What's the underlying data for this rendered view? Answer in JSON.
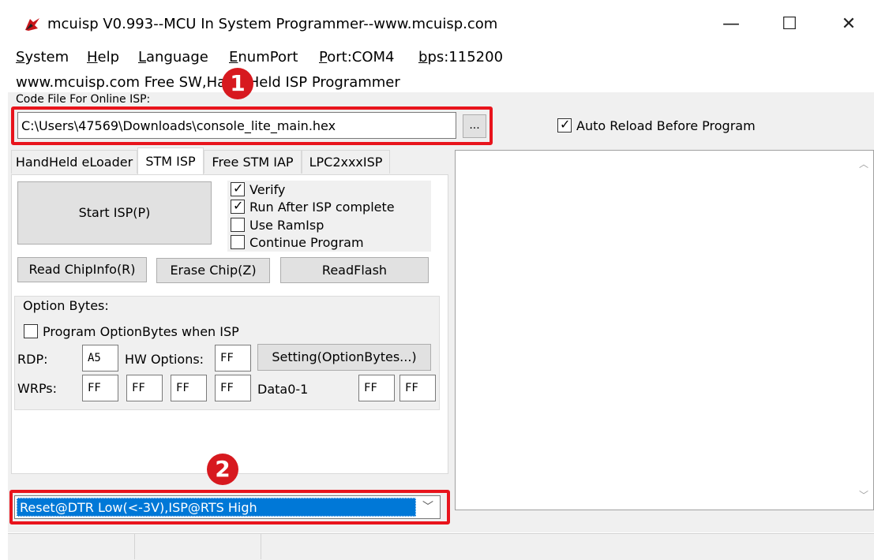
{
  "window": {
    "title": "mcuisp V0.993--MCU In System Programmer--www.mcuisp.com",
    "minimize_glyph": "—",
    "maximize_glyph": "☐",
    "close_glyph": "✕"
  },
  "menu": {
    "system_first": "S",
    "system_rest": "ystem",
    "help_first": "H",
    "help_rest": "elp",
    "language_first": "L",
    "language_rest": "anguage",
    "enumport_first": "E",
    "enumport_rest": "numPort",
    "port_first": "P",
    "port_rest": "ort:COM4",
    "bps_first": "b",
    "bps_rest": "ps:115200"
  },
  "subtitle": "www.mcuisp.com Free SW,Hand Held ISP Programmer",
  "code_file": {
    "label": "Code File For Online ISP:",
    "path": "C:\\Users\\47569\\Downloads\\console_lite_main.hex",
    "browse_label": "..."
  },
  "auto_reload": {
    "label": "Auto Reload Before Program",
    "checked": true
  },
  "badges": {
    "one": "1",
    "two": "2"
  },
  "tabs": [
    "HandHeld eLoader",
    "STM ISP",
    "Free STM IAP",
    "LPC2xxxISP"
  ],
  "stm_isp": {
    "start_button": "Start ISP(P)",
    "verify": "Verify",
    "run_after": "Run After ISP complete",
    "use_ramisp": "Use RamIsp",
    "continue_program": "Continue Program",
    "read_chipinfo": "Read ChipInfo(R)",
    "erase_chip": "Erase Chip(Z)",
    "read_flash": "ReadFlash"
  },
  "option_bytes": {
    "group_label": "Option Bytes:",
    "program_when_isp": "Program OptionBytes when ISP",
    "rdp_label": "RDP:",
    "rdp_value": "A5",
    "hw_label": "HW Options:",
    "hw_value": "FF",
    "setting_button": "Setting(OptionBytes...)",
    "wrps_label": "WRPs:",
    "wrps": [
      "FF",
      "FF",
      "FF",
      "FF"
    ],
    "data_label": "Data0-1",
    "data": [
      "FF",
      "FF"
    ]
  },
  "reset_mode": {
    "selected": "Reset@DTR Low(<-3V),ISP@RTS High",
    "arrow": "﹀"
  },
  "log_scroll": {
    "up": "︿",
    "down": "﹀"
  },
  "colors": {
    "highlight_red": "#e8141c",
    "badge_red": "#d7191f",
    "selection_blue": "#0078d7"
  }
}
